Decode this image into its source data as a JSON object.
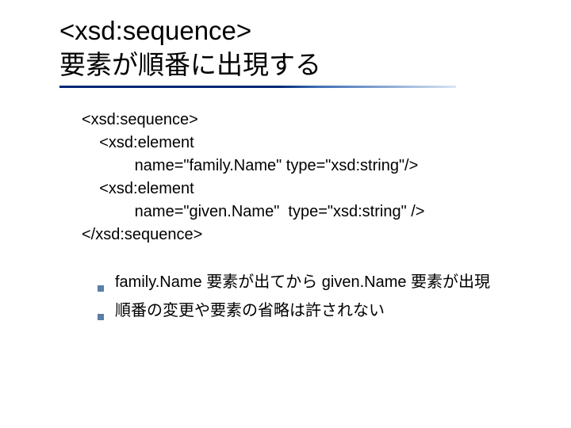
{
  "title_line1": "<xsd:sequence>",
  "title_line2": "要素が順番に出現する",
  "code": "<xsd:sequence>\n    <xsd:element\n            name=\"family.Name\" type=\"xsd:string\"/>\n    <xsd:element\n            name=\"given.Name\"  type=\"xsd:string\" />\n</xsd:sequence>",
  "bullets": [
    "family.Name 要素が出てから given.Name 要素が出現",
    "順番の変更や要素の省略は許されない"
  ]
}
